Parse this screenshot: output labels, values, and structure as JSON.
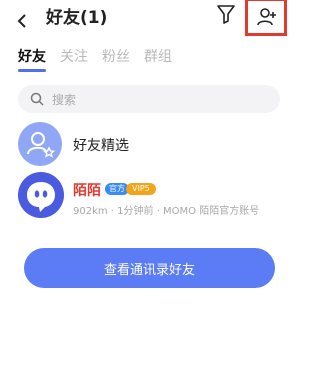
{
  "header": {
    "title": "好友(1)",
    "back_icon": "chevron-left-icon",
    "filter_icon": "filter-icon",
    "add_friend_icon": "user-add-icon"
  },
  "tabs": [
    {
      "label": "好友",
      "active": true
    },
    {
      "label": "关注",
      "active": false
    },
    {
      "label": "粉丝",
      "active": false
    },
    {
      "label": "群组",
      "active": false
    }
  ],
  "search": {
    "placeholder": "搜索"
  },
  "list": [
    {
      "label": "好友精选",
      "icon": "user-star-icon"
    },
    {
      "name": "陌陌",
      "badges": [
        "官方",
        "VIP5"
      ],
      "subtitle": "902km · 1分钟前 · MOMO 陌陌官方账号"
    }
  ],
  "cta": {
    "label": "查看通讯录好友"
  },
  "colors": {
    "accent": "#5b7cf4",
    "highlight_box": "#e23a2e",
    "name_red": "#e23a2e"
  }
}
